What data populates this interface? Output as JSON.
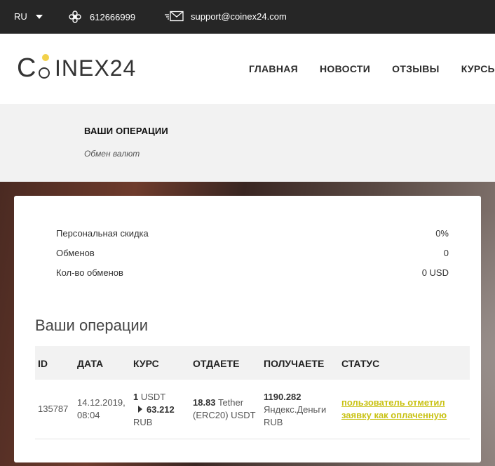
{
  "topbar": {
    "language": "RU",
    "phone": "612666999",
    "email": "support@coinex24.com"
  },
  "logo": {
    "first": "C",
    "rest": "INEX24"
  },
  "nav": [
    "ГЛАВНАЯ",
    "НОВОСТИ",
    "ОТЗЫВЫ",
    "КУРСЫ С"
  ],
  "band": {
    "title": "ВАШИ ОПЕРАЦИИ",
    "subtitle": "Обмен валют"
  },
  "stats": [
    {
      "label": "Персональная скидка",
      "value": "0%"
    },
    {
      "label": "Обменов",
      "value": "0"
    },
    {
      "label": "Кол-во обменов",
      "value": "0 USD"
    }
  ],
  "operations": {
    "heading": "Ваши операции",
    "columns": [
      "ID",
      "ДАТА",
      "КУРС",
      "ОТДАЕТЕ",
      "ПОЛУЧАЕТЕ",
      "СТАТУС"
    ],
    "row": {
      "id": "135787",
      "date_line1": "14.12.2019,",
      "date_line2": "08:04",
      "rate_amount": "1",
      "rate_from": "USDT",
      "rate_value": "63.212",
      "rate_to": "RUB",
      "give_amount": "18.83",
      "give_currency_line1": "Tether",
      "give_currency_line2": "(ERC20) USDT",
      "get_amount": "1190.282",
      "get_currency_line1": "Яндекс.Деньги",
      "get_currency_line2": "RUB",
      "status_line1": "пользователь отметил",
      "status_line2": "заявку как оплаченную"
    }
  },
  "colors": {
    "topbar": "#262626",
    "accent": "#f2d14a",
    "status": "#c9c214"
  }
}
